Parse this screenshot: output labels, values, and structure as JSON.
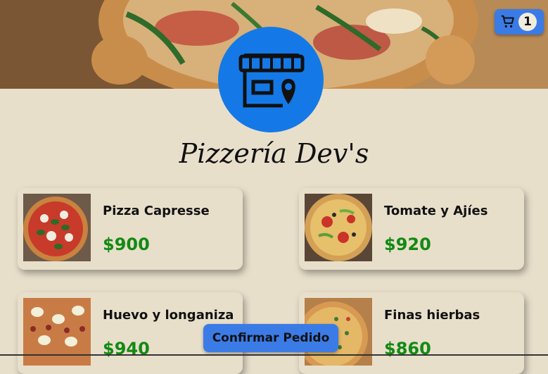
{
  "cart": {
    "count": "1",
    "icon": "cart-icon"
  },
  "brand": {
    "title": "Pizzería Dev's",
    "logo_icon": "store-location-icon"
  },
  "products": [
    {
      "name": "Pizza Capresse",
      "price": "$900"
    },
    {
      "name": "Tomate y Ajíes",
      "price": "$920"
    },
    {
      "name": "Huevo y longaniza",
      "price": "$940"
    },
    {
      "name": "Finas hierbas",
      "price": "$860"
    }
  ],
  "footer": {
    "confirm_label": "Confirmar Pedido"
  },
  "colors": {
    "accent": "#3b7be6",
    "logo_bg": "#1479e6",
    "price": "#138a13",
    "background": "#e8dfcb"
  }
}
